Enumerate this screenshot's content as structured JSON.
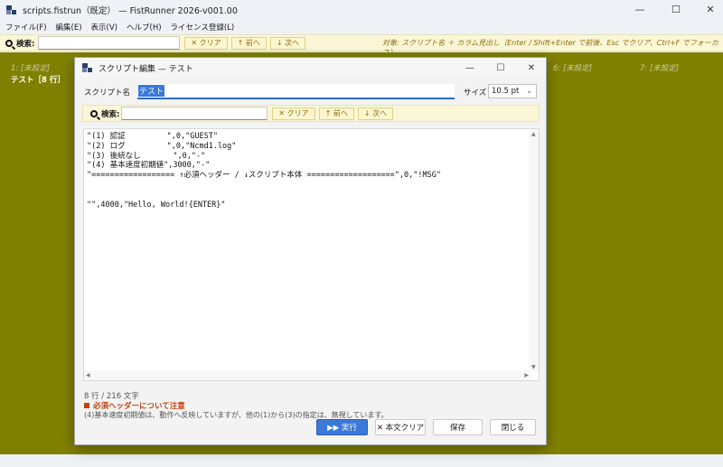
{
  "window": {
    "title": "scripts.fistrun（既定） — FistRunner 2026-v001.00",
    "minimize": "—",
    "maximize": "☐",
    "close": "✕"
  },
  "menu": [
    "ファイル(F)",
    "編集(E)",
    "表示(V)",
    "ヘルプ(H)",
    "ライセンス登録(L)"
  ],
  "search": {
    "label": "検索:",
    "value": "",
    "clear_label": "✕ クリア",
    "prev_label": "↑ 前へ",
    "next_label": "↓ 次へ",
    "hint": "対象: スクリプト名 ＋ カラム見出し（Enter / Shift+Enter で前後、Esc でクリア、Ctrl+F でフォーカス）"
  },
  "slots": {
    "slot1": "1: [未設定]",
    "active": "テスト［8 行］",
    "slot6": "6: [未設定]",
    "slot7": "7: [未設定]"
  },
  "dialog": {
    "title": "スクリプト編集 — テスト",
    "name_label": "スクリプト名",
    "name_value": "テスト",
    "size_label": "サイズ",
    "size_value": "10.5 pt",
    "search_label": "検索:",
    "search_value": "",
    "clear_label": "✕ クリア",
    "prev_label": "↑ 前へ",
    "next_label": "↓ 次へ",
    "code": "\"(1) 認証         \",0,\"GUEST\"\n\"(2) ログ         \",0,\"Ncmd1.log\"\n\"(3) 後続なし       \",0,\"-\"\n\"(4) 基本速度初期値\",3000,\"-\"\n\"================== ↑必須ヘッダー / ↓スクリプト本体 ===================\",0,\"!MSG\"\n\n\n\"\",4000,\"Hello, World!{ENTER}\"",
    "count_text": "8 行 / 216 文字",
    "warning_title": "必須ヘッダーについて注意",
    "warning_body": "(4)基本速度初期値は、動作へ反映していますが、他の(1)から(3)の指定は、無視しています。",
    "run_label": "▶▶ 実行",
    "clear_body_label": "✕ 本文クリア",
    "save_label": "保存",
    "close_label": "閉じる"
  },
  "colors": {
    "workarea": "#808000",
    "searchbar": "#fbf7d6",
    "accent": "#3b78d8",
    "warning": "#c2410c"
  }
}
